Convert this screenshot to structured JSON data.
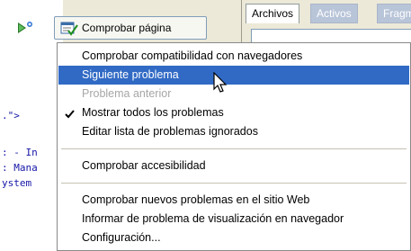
{
  "toolbar": {
    "check_page_label": "Comprobar página"
  },
  "files_panel": {
    "tabs": [
      {
        "label": "Archivos"
      },
      {
        "label": "Activos"
      },
      {
        "label": "Fragm"
      }
    ]
  },
  "code_editor": {
    "lines": [
      ".\">",
      ": - In",
      ": Mana",
      "ystem"
    ]
  },
  "menu": {
    "items": [
      {
        "label": "Comprobar compatibilidad con navegadores"
      },
      {
        "label": "Siguiente problema"
      },
      {
        "label": "Problema anterior"
      },
      {
        "label": "Mostrar todos los problemas"
      },
      {
        "label": "Editar lista de problemas ignorados"
      },
      {
        "label": "Comprobar accesibilidad"
      },
      {
        "label": "Comprobar nuevos problemas en el sitio Web"
      },
      {
        "label": "Informar de problema de visualización en navegador"
      },
      {
        "label": "Configuración..."
      }
    ]
  },
  "colors": {
    "highlight": "#316ac5",
    "disabled_text": "#a6a6a6"
  }
}
